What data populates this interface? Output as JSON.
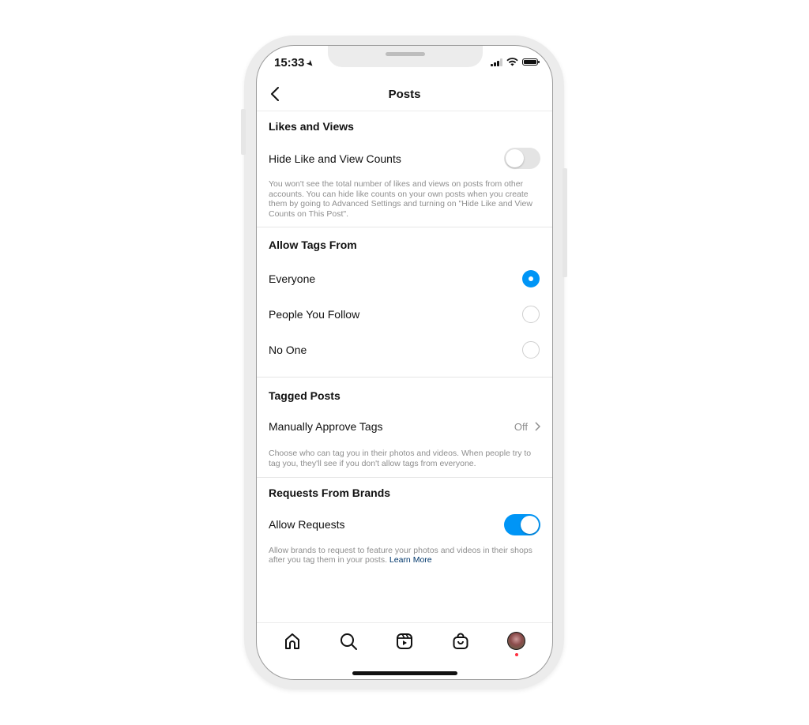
{
  "status_bar": {
    "time": "15:33",
    "location_icon": "location-arrow-icon",
    "icons": [
      "cellular-signal-icon",
      "wifi-icon",
      "battery-icon"
    ]
  },
  "nav": {
    "title": "Posts",
    "back_icon": "chevron-left-icon"
  },
  "sections": {
    "likes": {
      "title": "Likes and Views",
      "row_label": "Hide Like and View Counts",
      "toggle_on": false,
      "description": "You won't see the total number of likes and views on posts from other accounts. You can hide like counts on your own posts when you create them by going to Advanced Settings and turning on \"Hide Like and View Counts on This Post\"."
    },
    "tags": {
      "title": "Allow Tags From",
      "options": [
        {
          "label": "Everyone",
          "selected": true
        },
        {
          "label": "People You Follow",
          "selected": false
        },
        {
          "label": "No One",
          "selected": false
        }
      ]
    },
    "tagged": {
      "title": "Tagged Posts",
      "row_label": "Manually Approve Tags",
      "row_value": "Off",
      "description": "Choose who can tag you in their photos and videos. When people try to tag you, they'll see if you don't allow tags from everyone."
    },
    "brands": {
      "title": "Requests From Brands",
      "row_label": "Allow Requests",
      "toggle_on": true,
      "description": "Allow brands to request to feature your photos and videos in their shops after you tag them in your posts.",
      "link": "Learn More"
    }
  },
  "tab_bar": {
    "items": [
      "home-icon",
      "search-icon",
      "reels-icon",
      "shop-icon",
      "profile-avatar"
    ]
  },
  "colors": {
    "accent": "#0095f6",
    "secondary_text": "#8e8e8e",
    "link": "#00376b",
    "notification_dot": "#ff3040"
  }
}
